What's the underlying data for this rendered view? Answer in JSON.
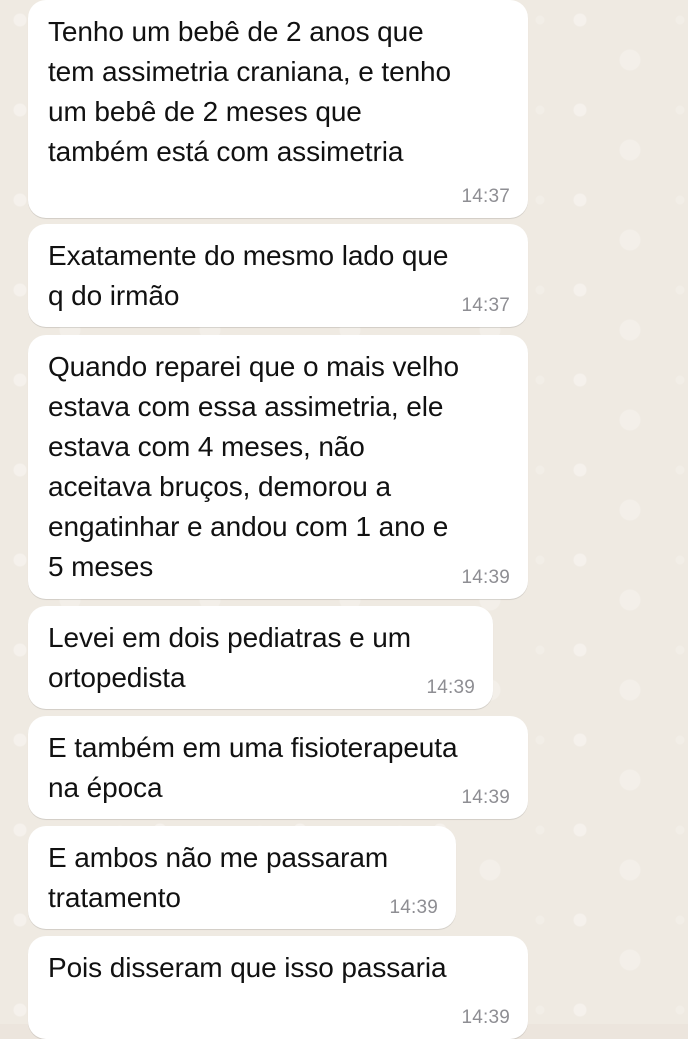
{
  "messages": [
    {
      "text": "Tenho um bebê de 2 anos que\ntem assimetria craniana, e tenho\num bebê de 2 meses que\ntambém está com assimetria",
      "time": "14:37"
    },
    {
      "text": "Exatamente do mesmo lado que\nq do irmão",
      "time": "14:37"
    },
    {
      "text": "Quando reparei que o mais velho\nestava com essa assimetria, ele\nestava com 4 meses, não\naceitava bruços, demorou a\nengatinhar e andou com 1 ano e\n5 meses",
      "time": "14:39"
    },
    {
      "text": "Levei em dois pediatras e um\nortopedista",
      "time": "14:39"
    },
    {
      "text": "E também em uma fisioterapeuta\nna época",
      "time": "14:39"
    },
    {
      "text": "E ambos não me passaram\ntratamento",
      "time": "14:39"
    },
    {
      "text": "Pois disseram que isso passaria",
      "time": "14:39"
    }
  ]
}
